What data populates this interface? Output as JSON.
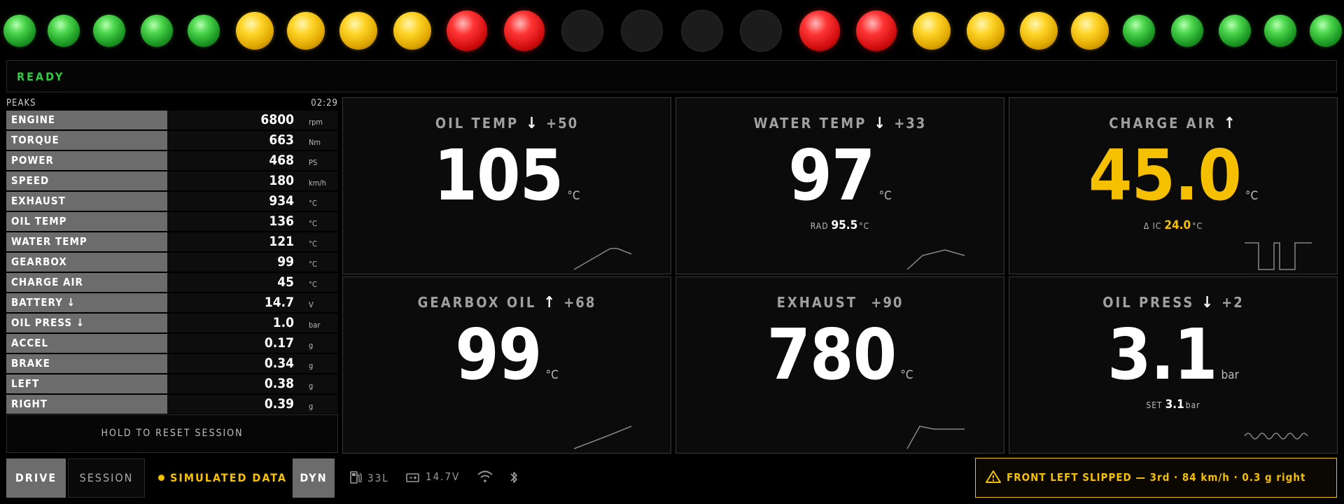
{
  "leds": [
    {
      "color": "green",
      "state": "on"
    },
    {
      "color": "green",
      "state": "on"
    },
    {
      "color": "green",
      "state": "on"
    },
    {
      "color": "green",
      "state": "on"
    },
    {
      "color": "green",
      "state": "on"
    },
    {
      "color": "yellow",
      "state": "on"
    },
    {
      "color": "yellow",
      "state": "on"
    },
    {
      "color": "yellow",
      "state": "on"
    },
    {
      "color": "yellow",
      "state": "on"
    },
    {
      "color": "red",
      "state": "on"
    },
    {
      "color": "red",
      "state": "on"
    },
    {
      "color": "off",
      "state": "off"
    },
    {
      "color": "off",
      "state": "off"
    },
    {
      "color": "off",
      "state": "off"
    },
    {
      "color": "off",
      "state": "off"
    },
    {
      "color": "red",
      "state": "on"
    },
    {
      "color": "red",
      "state": "on"
    },
    {
      "color": "yellow",
      "state": "on"
    },
    {
      "color": "yellow",
      "state": "on"
    },
    {
      "color": "yellow",
      "state": "on"
    },
    {
      "color": "yellow",
      "state": "on"
    },
    {
      "color": "green",
      "state": "on"
    },
    {
      "color": "green",
      "state": "on"
    },
    {
      "color": "green",
      "state": "on"
    },
    {
      "color": "green",
      "state": "on"
    },
    {
      "color": "green",
      "state": "on"
    }
  ],
  "status": {
    "text": "READY",
    "color": "#2ecc40"
  },
  "peaks": {
    "title": "PEAKS",
    "session_time": "02:29",
    "rows": [
      {
        "label": "ENGINE",
        "value": "6800",
        "unit": "rpm"
      },
      {
        "label": "TORQUE",
        "value": "663",
        "unit": "Nm"
      },
      {
        "label": "POWER",
        "value": "468",
        "unit": "PS"
      },
      {
        "label": "SPEED",
        "value": "180",
        "unit": "km/h"
      },
      {
        "label": "EXHAUST",
        "value": "934",
        "unit": "°C"
      },
      {
        "label": "OIL TEMP",
        "value": "136",
        "unit": "°C"
      },
      {
        "label": "WATER TEMP",
        "value": "121",
        "unit": "°C"
      },
      {
        "label": "GEARBOX",
        "value": "99",
        "unit": "°C"
      },
      {
        "label": "CHARGE AIR",
        "value": "45",
        "unit": "°C"
      },
      {
        "label": "BATTERY ↓",
        "value": "14.7",
        "unit": "V"
      },
      {
        "label": "OIL PRESS ↓",
        "value": "1.0",
        "unit": "bar"
      },
      {
        "label": "ACCEL",
        "value": "0.17",
        "unit": "g"
      },
      {
        "label": "BRAKE",
        "value": "0.34",
        "unit": "g"
      },
      {
        "label": "LEFT",
        "value": "0.38",
        "unit": "g"
      },
      {
        "label": "RIGHT",
        "value": "0.39",
        "unit": "g"
      }
    ],
    "reset_label": "HOLD TO RESET SESSION"
  },
  "tiles": {
    "oil_temp": {
      "title": "OIL TEMP",
      "arrow": "↓",
      "delta": "+50",
      "value": "105",
      "unit": "°C"
    },
    "water_temp": {
      "title": "WATER TEMP",
      "arrow": "↓",
      "delta": "+33",
      "value": "97",
      "unit": "°C",
      "sub_label": "RAD",
      "sub_value": "95.5",
      "sub_unit": "°C"
    },
    "charge_air": {
      "title": "CHARGE AIR",
      "arrow": "↑",
      "delta": "",
      "value": "45.0",
      "unit": "°C",
      "sub_label": "Δ IC",
      "sub_value": "24.0",
      "sub_unit": "°C",
      "accent": "#f5c000"
    },
    "gearbox_oil": {
      "title": "GEARBOX OIL",
      "arrow": "↑",
      "delta": "+68",
      "value": "99",
      "unit": "°C"
    },
    "exhaust": {
      "title": "EXHAUST",
      "arrow": "",
      "delta": "+90",
      "value": "780",
      "unit": "°C"
    },
    "oil_press": {
      "title": "OIL PRESS",
      "arrow": "↓",
      "delta": "+2",
      "value": "3.1",
      "unit": "bar",
      "sub_label": "SET",
      "sub_value": "3.1",
      "sub_unit": "bar"
    }
  },
  "bottom": {
    "drive_label": "DRIVE",
    "session_label": "SESSION",
    "sim_label": "SIMULATED DATA",
    "dyn_label": "DYN",
    "fuel": "33L",
    "battery": "14.7V",
    "wifi_icon": "wifi-icon",
    "bluetooth_icon": "bluetooth-icon",
    "alert": "FRONT LEFT SLIPPED — 3rd · 84 km/h · 0.3 g right",
    "alert_color": "#f5c000"
  }
}
